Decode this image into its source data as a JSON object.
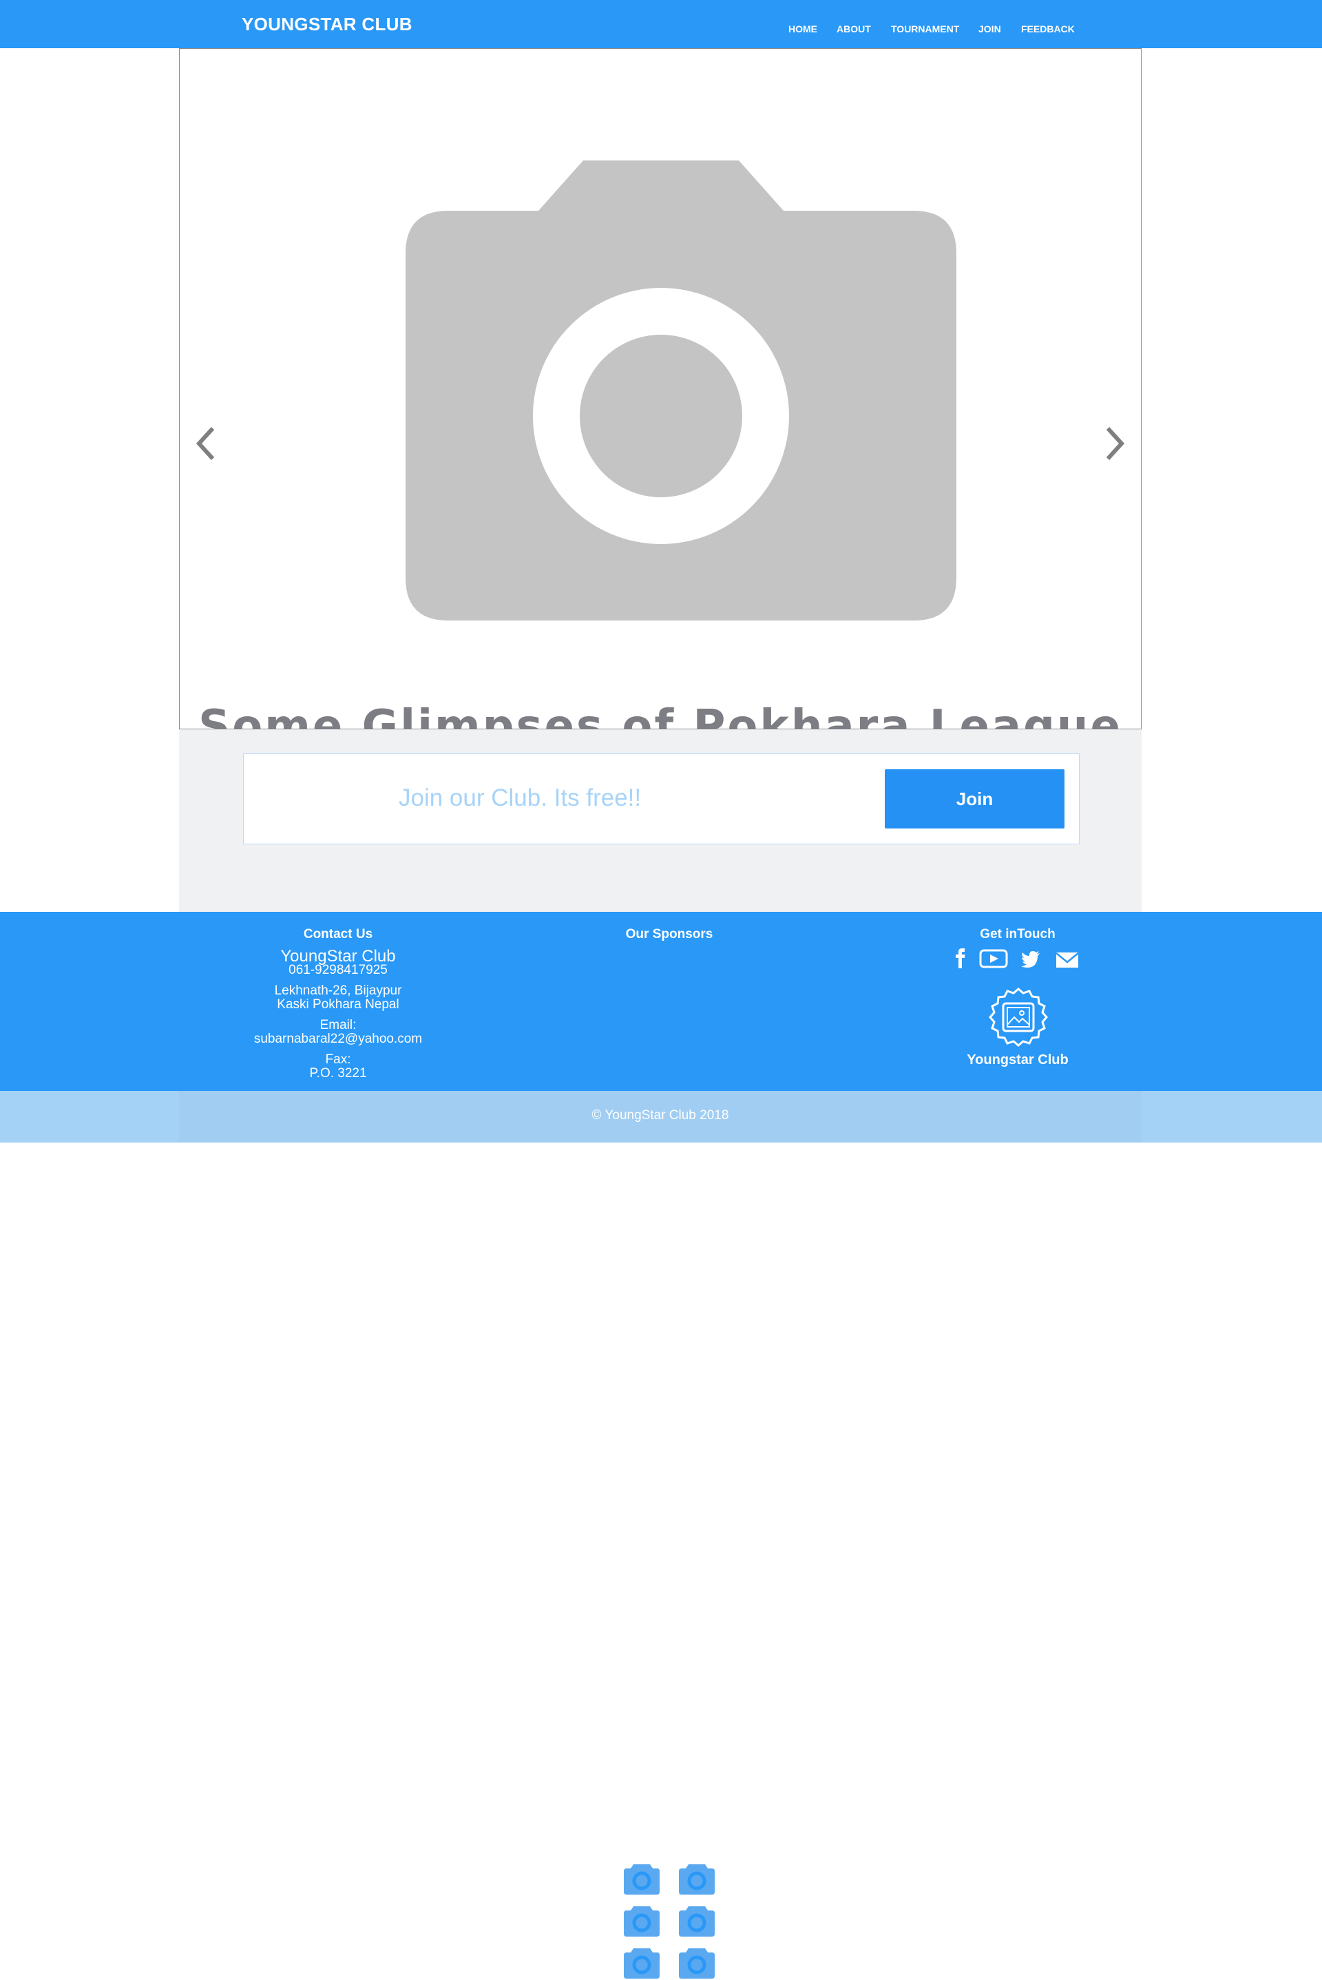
{
  "header": {
    "brand": "YOUNGSTAR CLUB",
    "nav": [
      "HOME",
      "ABOUT",
      "TOURNAMENT",
      "JOIN",
      "FEEDBACK"
    ]
  },
  "hero": {
    "caption": "Some Glimpses of Pokhara League",
    "image_icon": "camera-icon"
  },
  "join": {
    "prompt": "Join our Club. Its free!!",
    "button": "Join"
  },
  "footer": {
    "contact": {
      "heading": "Contact Us",
      "club": "YoungStar Club",
      "phone": "061-9298417925",
      "address_line1": "Lekhnath-26, Bijaypur",
      "address_line2": "Kaski Pokhara Nepal",
      "email_label": "Email:",
      "email": "subarnabaral22@yahoo.com",
      "fax_label": "Fax:",
      "po_box": "P.O. 3221"
    },
    "sponsors": {
      "heading": "Our Sponsors",
      "logo_icon": "camera-icon"
    },
    "get_in_touch": {
      "heading": "Get inTouch",
      "social_icons": [
        "facebook-icon",
        "youtube-icon",
        "twitter-icon",
        "mail-icon"
      ],
      "badge_label": "Youngstar Club"
    }
  },
  "copyright": "© YoungStar Club 2018",
  "colors": {
    "primary": "#2998f7",
    "button": "#2591f5",
    "placeholder_gray": "#c4c4c4",
    "caption_gray": "#7d7d84",
    "section_bg": "#f0f1f3",
    "bottom_bar": "#a4d2f7"
  }
}
